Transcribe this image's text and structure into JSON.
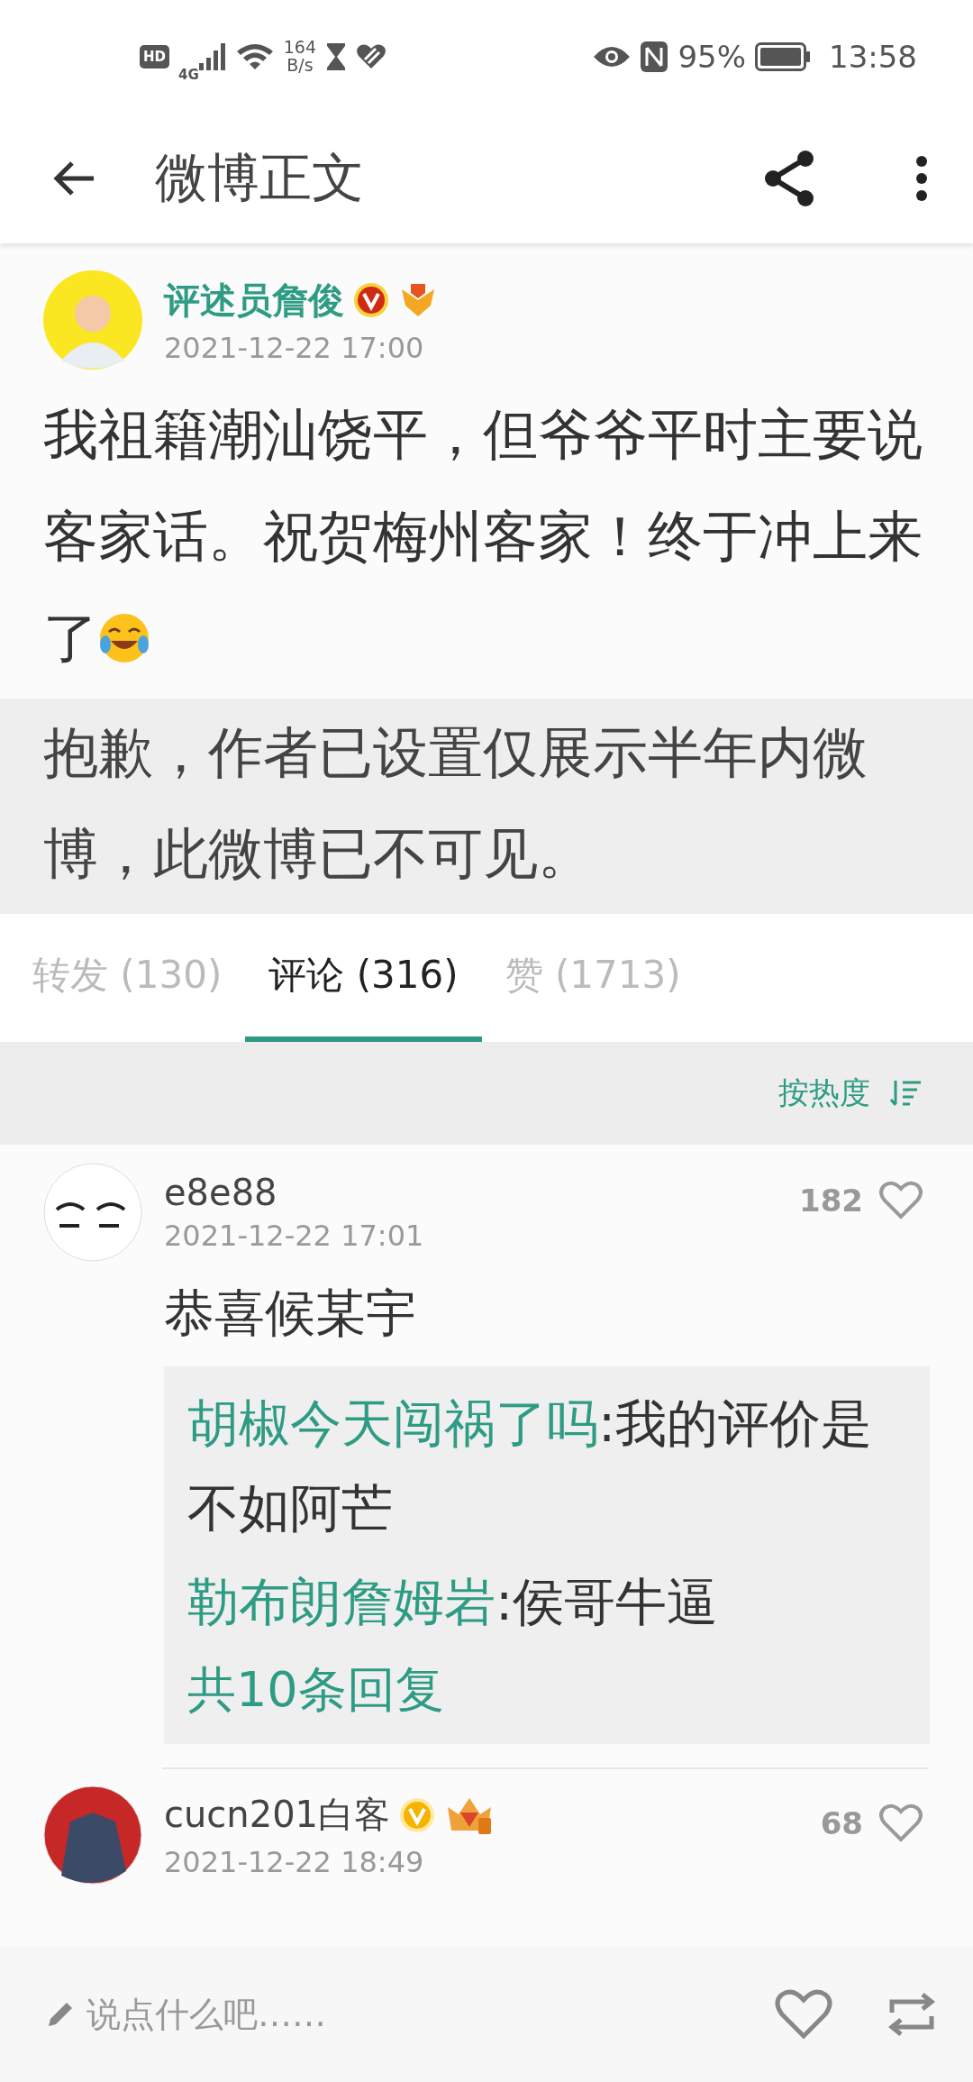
{
  "status_bar": {
    "hd": "HD",
    "network": "4G",
    "speed": "164",
    "speed_unit": "B/s",
    "battery": "95%",
    "time": "13:58"
  },
  "toolbar": {
    "title": "微博正文"
  },
  "post": {
    "author": "评述员詹俊",
    "verified": true,
    "color": "#d22a12",
    "time": "2021-12-22 17:00",
    "text": "我祖籍潮汕饶平，但爷爷平时主要说客家话。祝贺梅州客家！终于冲上来了",
    "notice": "抱歉，作者已设置仅展示半年内微博，此微博已不可见。"
  },
  "tabs": [
    {
      "label": "转发 (130)",
      "selected": false
    },
    {
      "label": "评论 (316)",
      "selected": true
    },
    {
      "label": "赞 (1713)",
      "selected": false
    }
  ],
  "sort": {
    "label": "按热度"
  },
  "comments": [
    {
      "user": "e8e88",
      "verified": false,
      "time": "2021-12-22 17:01",
      "likes": "182",
      "text": "恭喜候某宇",
      "replies": [
        {
          "user": "胡椒今天闯祸了吗",
          "text": ":我的评价是不如阿芒"
        },
        {
          "user": "勒布朗詹姆岩",
          "text": ":侯哥牛逼"
        }
      ],
      "more": "共10条回复"
    },
    {
      "user": "cucn201白客",
      "verified": true,
      "color": "#f5b400",
      "time": "2021-12-22 18:49",
      "likes": "68"
    }
  ],
  "composer": {
    "placeholder": "说点什么吧……"
  }
}
